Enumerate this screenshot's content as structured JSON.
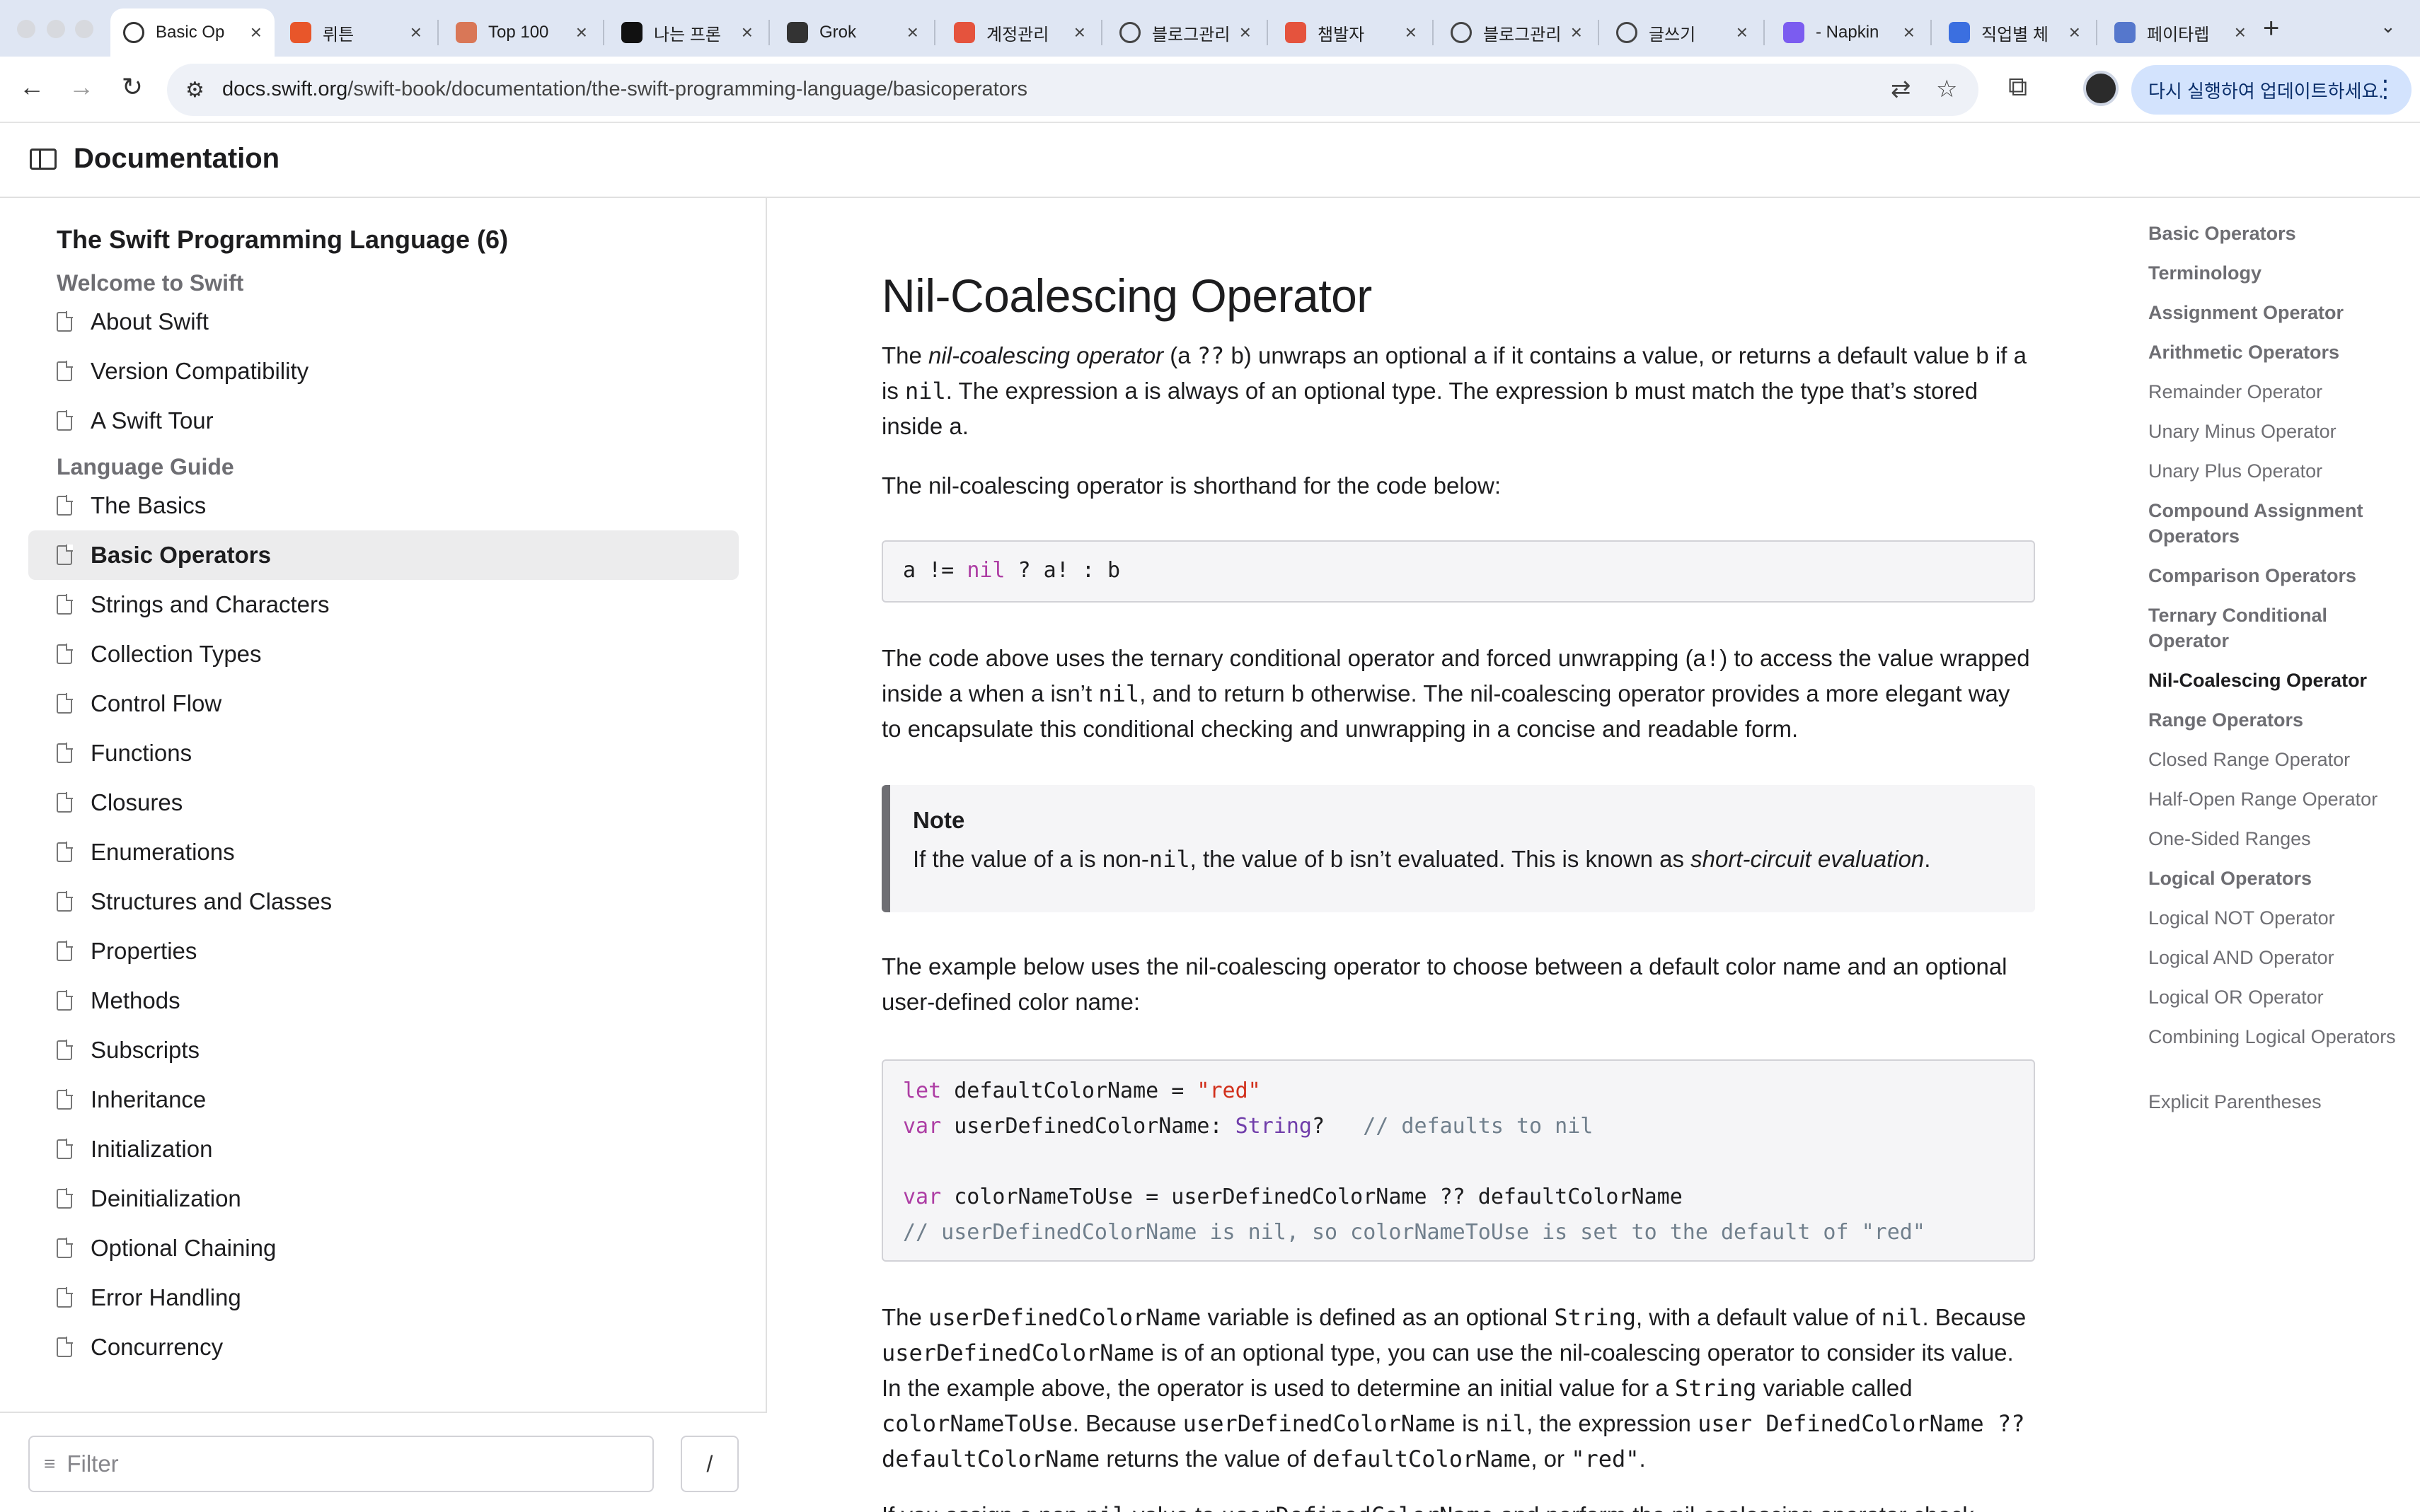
{
  "browser": {
    "tabs": [
      {
        "label": "Basic Op",
        "active": true,
        "favicon": "globe-icon",
        "color": "#ffffff"
      },
      {
        "label": "뤼튼",
        "favicon": "wrtn-icon",
        "color": "#e8562a"
      },
      {
        "label": "Top 100",
        "favicon": "claude-icon",
        "color": "#d97757"
      },
      {
        "label": "나는 프론",
        "favicon": "cursor-icon",
        "color": "#111111"
      },
      {
        "label": "Grok",
        "favicon": "grok-icon",
        "color": "#333333"
      },
      {
        "label": "계정관리",
        "favicon": "tistory-icon",
        "color": "#e5533d"
      },
      {
        "label": "블로그관리",
        "favicon": "globe-icon",
        "color": "#444444"
      },
      {
        "label": "챔발자",
        "favicon": "tistory-icon",
        "color": "#e5533d"
      },
      {
        "label": "블로그관리",
        "favicon": "globe-icon",
        "color": "#444444"
      },
      {
        "label": "글쓰기",
        "favicon": "globe-icon",
        "color": "#444444"
      },
      {
        "label": "- Napkin",
        "favicon": "napkin-icon",
        "color": "#7b5cf0"
      },
      {
        "label": "직업별 체",
        "favicon": "s-icon",
        "color": "#3b6fe0"
      },
      {
        "label": "페이타렙",
        "favicon": "link-icon",
        "color": "#5577cc"
      }
    ],
    "url_domain": "docs.swift.org",
    "url_path": "/swift-book/documentation/the-swift-programming-language/basicoperators",
    "update_label": "다시 실행하여 업데이트하세요."
  },
  "header": {
    "title": "Documentation"
  },
  "navigator": {
    "book_title": "The Swift Programming Language (6)",
    "sections": [
      {
        "title": "Welcome to Swift",
        "items": [
          "About Swift",
          "Version Compatibility",
          "A Swift Tour"
        ]
      },
      {
        "title": "Language Guide",
        "items": [
          "The Basics",
          "Basic Operators",
          "Strings and Characters",
          "Collection Types",
          "Control Flow",
          "Functions",
          "Closures",
          "Enumerations",
          "Structures and Classes",
          "Properties",
          "Methods",
          "Subscripts",
          "Inheritance",
          "Initialization",
          "Deinitialization",
          "Optional Chaining",
          "Error Handling",
          "Concurrency"
        ]
      }
    ],
    "selected": "Basic Operators",
    "filter_placeholder": "Filter",
    "filter_shortcut": "/"
  },
  "content": {
    "heading": "Nil-Coalescing Operator",
    "p1": {
      "a": "The ",
      "em": "nil-coalescing operator",
      "b": " (a ",
      "code1": "??",
      "c": " b) unwraps an optional a if it contains a value, or returns a default value b if a is ",
      "code2": "nil",
      "d": ". The expression a is always of an optional type. The expression b must match the type that’s stored inside a."
    },
    "p2": "The nil-coalescing operator is shorthand for the code below:",
    "code1": {
      "a": "a != ",
      "kw": "nil",
      "b": " ? a! : b"
    },
    "p3": {
      "a": "The code above uses the ternary conditional operator and forced unwrapping (a",
      "code1": "!",
      "b": ") to access the value wrapped inside a when a isn’t ",
      "code2": "nil",
      "c": ", and to return b otherwise. The nil-coalescing operator provides a more elegant way to encapsulate this conditional checking and unwrapping in a concise and readable form."
    },
    "note": {
      "label": "Note",
      "a": "If the value of a is non-",
      "code": "nil",
      "b": ", the value of b isn’t evaluated. This is known as ",
      "em": "short-circuit evaluation",
      "c": "."
    },
    "p4": "The example below uses the nil-coalescing operator to choose between a default color name and an optional user-defined color name:",
    "code2": {
      "l1_kw": "let",
      "l1_a": " defaultColorName = ",
      "l1_str": "\"red\"",
      "l2_kw": "var",
      "l2_a": " userDefinedColorName: ",
      "l2_type": "String",
      "l2_b": "?   ",
      "l2_cmt": "// defaults to nil",
      "l4_kw": "var",
      "l4_a": " colorNameToUse = userDefinedColorName ?? defaultColorName",
      "l5_cmt": "// userDefinedColorName is nil, so colorNameToUse is set to the default of \"red\""
    },
    "p5": {
      "a": "The ",
      "c1": "userDefinedColorName",
      "b": " variable is defined as an optional ",
      "c2": "String",
      "c": ", with a default value of ",
      "c3": "nil",
      "d": ". Because ",
      "c4": "userDefinedColorName",
      "e": " is of an optional type, you can use the nil-coalescing operator to consider its value. In the example above, the operator is used to determine an initial value for a ",
      "c5": "String",
      "f": " variable called ",
      "c6": "colorNameToUse",
      "g": ". Because ",
      "c7": "userDefinedColorName",
      "h": " is ",
      "c8": "nil",
      "i": ", the expression ",
      "c9": "user DefinedColorName ?? defaultColorName",
      "j": " returns the value of ",
      "c10": "defaultColorName",
      "k": ", or ",
      "c11": "\"red\"",
      "l": "."
    },
    "p6": {
      "a": "If you assign a non-",
      "c1": "nil",
      "b": " value to ",
      "c2": "userDefinedColorName",
      "c": " and perform the nil-coalescing operator check"
    }
  },
  "on_this_page": [
    {
      "label": "Basic Operators",
      "level": 1
    },
    {
      "label": "Terminology",
      "level": 1
    },
    {
      "label": "Assignment Operator",
      "level": 1
    },
    {
      "label": "Arithmetic Operators",
      "level": 1
    },
    {
      "label": "Remainder Operator",
      "level": 2
    },
    {
      "label": "Unary Minus Operator",
      "level": 2
    },
    {
      "label": "Unary Plus Operator",
      "level": 2
    },
    {
      "label": "Compound Assignment Operators",
      "level": 1
    },
    {
      "label": "Comparison Operators",
      "level": 1
    },
    {
      "label": "Ternary Conditional Operator",
      "level": 1
    },
    {
      "label": "Nil-Coalescing Operator",
      "level": 1,
      "current": true
    },
    {
      "label": "Range Operators",
      "level": 1
    },
    {
      "label": "Closed Range Operator",
      "level": 2
    },
    {
      "label": "Half-Open Range Operator",
      "level": 2
    },
    {
      "label": "One-Sided Ranges",
      "level": 2
    },
    {
      "label": "Logical Operators",
      "level": 1
    },
    {
      "label": "Logical NOT Operator",
      "level": 2
    },
    {
      "label": "Logical AND Operator",
      "level": 2
    },
    {
      "label": "Logical OR Operator",
      "level": 2
    },
    {
      "label": "Combining Logical Operators",
      "level": 2
    },
    {
      "label": "Explicit Parentheses",
      "level": 2
    }
  ]
}
